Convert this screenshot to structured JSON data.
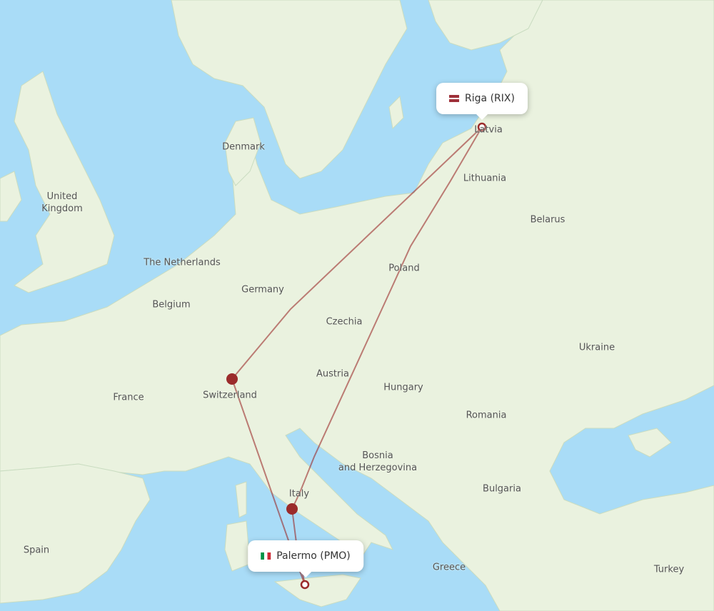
{
  "origin": {
    "city": "Palermo (PMO)",
    "flag": "italy-flag",
    "flag_colors": [
      "#009246",
      "#ffffff",
      "#ce2b37"
    ]
  },
  "destination": {
    "city": "Riga (RIX)",
    "flag": "latvia-flag",
    "flag_colors": [
      "#9e3039",
      "#ffffff",
      "#9e3039"
    ]
  },
  "route_color": "#9b2b2b",
  "colors": {
    "sea": "#a9dcf7",
    "land": "#eaf2df"
  },
  "countries": [
    {
      "name": "Denmark"
    },
    {
      "name": "United Kingdom"
    },
    {
      "name": "The Netherlands"
    },
    {
      "name": "Belgium"
    },
    {
      "name": "Germany"
    },
    {
      "name": "France"
    },
    {
      "name": "Switzerland"
    },
    {
      "name": "Austria"
    },
    {
      "name": "Czechia"
    },
    {
      "name": "Poland"
    },
    {
      "name": "Lithuania"
    },
    {
      "name": "Latvia"
    },
    {
      "name": "Belarus"
    },
    {
      "name": "Ukraine"
    },
    {
      "name": "Hungary"
    },
    {
      "name": "Romania"
    },
    {
      "name": "Bosnia\nand Herzegovina"
    },
    {
      "name": "Bulgaria"
    },
    {
      "name": "Italy"
    },
    {
      "name": "Spain"
    },
    {
      "name": "Greece"
    },
    {
      "name": "Turkey"
    }
  ]
}
